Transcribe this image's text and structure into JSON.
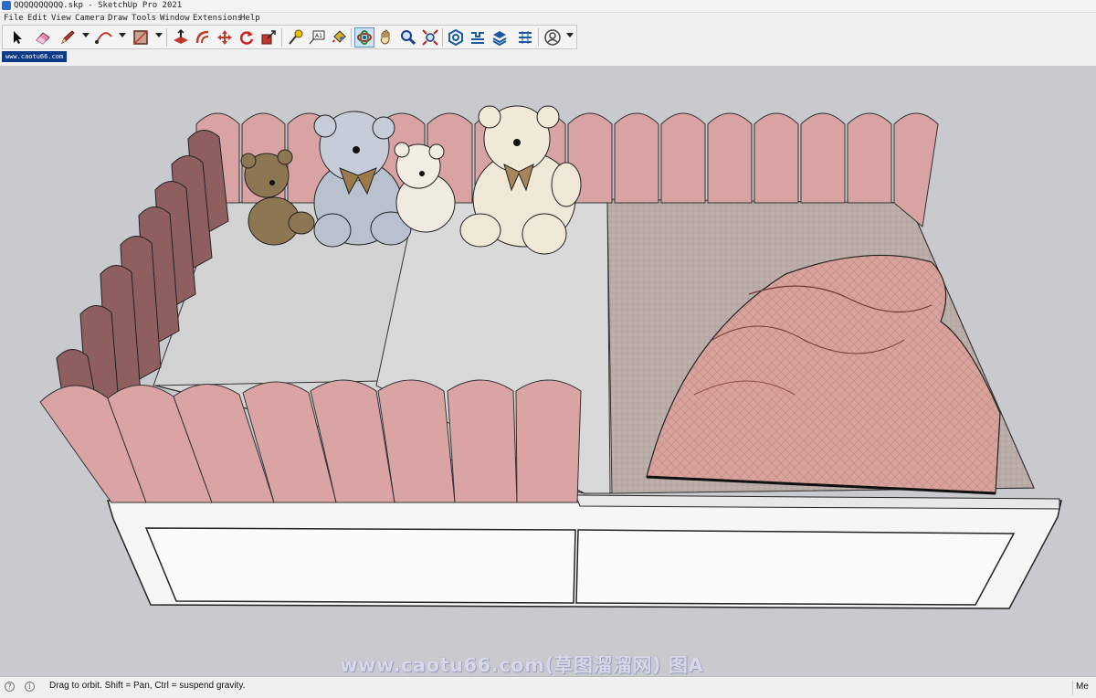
{
  "window": {
    "title": "QQQQQQQQQQ.skp - SketchUp Pro 2021"
  },
  "menu": [
    "File",
    "Edit",
    "View",
    "Camera",
    "Draw",
    "Tools",
    "Window",
    "Extensions",
    "Help"
  ],
  "toolbar": {
    "tools": [
      {
        "name": "select-tool",
        "icon": "arrow-cursor-icon"
      },
      {
        "name": "eraser-tool",
        "icon": "eraser-icon"
      },
      {
        "name": "line-tool",
        "icon": "pencil-icon",
        "dropdown": true
      },
      {
        "name": "arc-tool",
        "icon": "arc-icon",
        "dropdown": true
      },
      {
        "name": "rectangle-tool",
        "icon": "rectangle-icon",
        "dropdown": true
      },
      {
        "name": "push-pull-tool",
        "icon": "push-pull-icon"
      },
      {
        "name": "offset-tool",
        "icon": "offset-icon"
      },
      {
        "name": "move-tool",
        "icon": "move-icon"
      },
      {
        "name": "rotate-tool",
        "icon": "rotate-icon"
      },
      {
        "name": "scale-tool",
        "icon": "scale-icon"
      },
      {
        "name": "tape-measure-tool",
        "icon": "tape-measure-icon"
      },
      {
        "name": "text-tool",
        "icon": "text-icon"
      },
      {
        "name": "paint-bucket-tool",
        "icon": "paint-bucket-icon"
      },
      {
        "name": "orbit-tool",
        "icon": "orbit-icon",
        "active": true
      },
      {
        "name": "pan-tool",
        "icon": "hand-icon"
      },
      {
        "name": "zoom-tool",
        "icon": "magnifier-icon"
      },
      {
        "name": "zoom-extents-tool",
        "icon": "zoom-extents-icon"
      },
      {
        "name": "3d-warehouse",
        "icon": "warehouse-icon"
      },
      {
        "name": "extension-warehouse",
        "icon": "extension-warehouse-icon"
      },
      {
        "name": "layout",
        "icon": "layers-stack-icon"
      },
      {
        "name": "extension-manager",
        "icon": "extension-manager-icon"
      },
      {
        "name": "account",
        "icon": "user-icon",
        "dropdown": true
      }
    ]
  },
  "scene_tab": "www.caotu66.com",
  "watermark": "www.caotu66.com(草图溜溜网) 图A",
  "status": {
    "message": "Drag to orbit. Shift = Pan, Ctrl = suspend gravity.",
    "measurements_label": "Me"
  },
  "colors": {
    "viewport_bg": "#c9cace",
    "headboard_pink": "#dba4a4",
    "sheet_grey": "#d8d8d8",
    "bed_frame": "#f4f4f4",
    "blanket_pink": "#d9a8a2",
    "active_tool": "#cfe3f7"
  }
}
